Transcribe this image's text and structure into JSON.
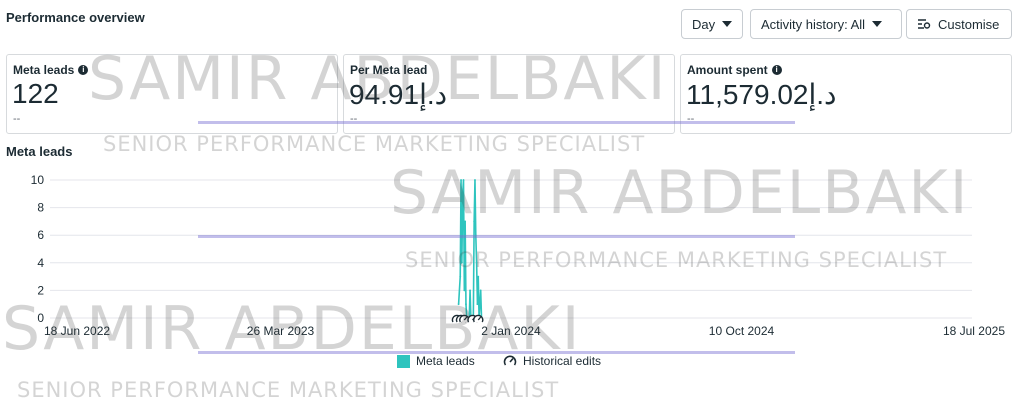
{
  "header": {
    "title": "Performance overview",
    "day_label": "Day",
    "activity_label": "Activity history: All",
    "customise_label": "Customise"
  },
  "metrics": [
    {
      "label": "Meta leads",
      "info": true,
      "value": "122",
      "sub": "--"
    },
    {
      "label": "Per Meta lead",
      "info": false,
      "value": "94.91د.إ",
      "sub": "--"
    },
    {
      "label": "Amount spent",
      "info": true,
      "value": "11,579.02د.إ",
      "sub": "--"
    }
  ],
  "section_title": "Meta leads",
  "legend": {
    "series_label": "Meta leads",
    "edits_label": "Historical edits"
  },
  "colors": {
    "series": "#2ec4be",
    "grid": "#e4e6eb",
    "text": "#1c2b33"
  },
  "watermark": {
    "name": "SAMIR ABDELBAKI",
    "tagline": "SENIOR PERFORMANCE MARKETING SPECIALIST"
  },
  "chart_data": {
    "type": "line",
    "title": "Meta leads",
    "ylim": [
      0,
      10
    ],
    "y_ticks": [
      "0",
      "2",
      "4",
      "6",
      "8",
      "10"
    ],
    "x_ticks": [
      "18 Jun 2022",
      "26 Mar 2023",
      "2 Jan 2024",
      "10 Oct 2024",
      "18 Jul 2025"
    ],
    "x_range": [
      "2022-06-18",
      "2025-07-18"
    ],
    "grid": true,
    "series": [
      {
        "name": "Meta leads",
        "points": [
          [
            "2023-10-30",
            1
          ],
          [
            "2023-11-01",
            3
          ],
          [
            "2023-11-02",
            10
          ],
          [
            "2023-11-03",
            4
          ],
          [
            "2023-11-04",
            9
          ],
          [
            "2023-11-05",
            10
          ],
          [
            "2023-11-06",
            2
          ],
          [
            "2023-11-07",
            7
          ],
          [
            "2023-11-08",
            1
          ],
          [
            "2023-11-09",
            0
          ],
          [
            "2023-11-12",
            0
          ],
          [
            "2023-11-13",
            2
          ],
          [
            "2023-11-14",
            0
          ],
          [
            "2023-11-17",
            0
          ],
          [
            "2023-11-18",
            7
          ],
          [
            "2023-11-19",
            10
          ],
          [
            "2023-11-20",
            6
          ],
          [
            "2023-11-21",
            4
          ],
          [
            "2023-11-22",
            1
          ],
          [
            "2023-11-23",
            3
          ],
          [
            "2023-11-24",
            0
          ],
          [
            "2023-11-25",
            1
          ],
          [
            "2023-11-26",
            2
          ],
          [
            "2023-11-27",
            0
          ]
        ]
      }
    ],
    "historical_edits": [
      "2023-10-28",
      "2023-11-02",
      "2023-11-06",
      "2023-11-16",
      "2023-11-23"
    ]
  }
}
